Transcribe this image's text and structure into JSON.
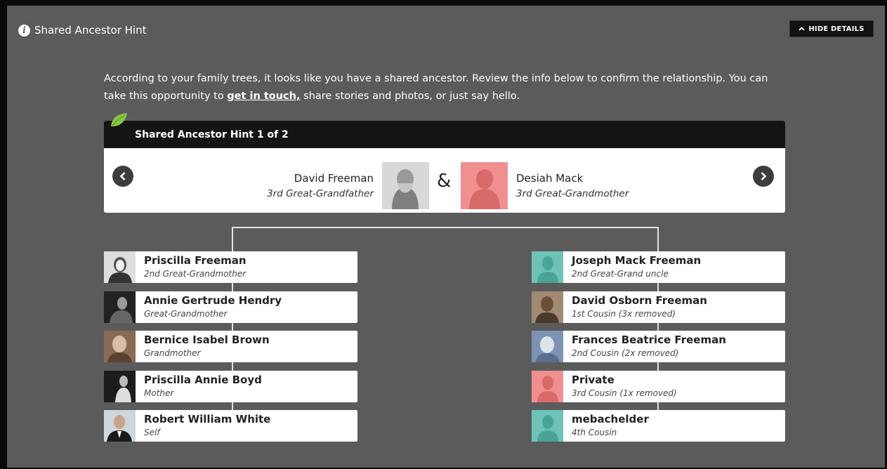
{
  "header": {
    "title": "Shared Ancestor Hint",
    "hide_details_label": "HIDE DETAILS"
  },
  "intro": {
    "text_before": "According to your family trees, it looks like you have a shared ancestor. Review the info below to confirm the relationship. You can take this opportunity to ",
    "link_text": "get in touch,",
    "text_after": " share stories and photos, or just say hello."
  },
  "hint": {
    "title": "Shared Ancestor Hint 1 of 2",
    "ampersand": "&",
    "ancestor1": {
      "name": "David Freeman",
      "relationship": "3rd Great-Grandfather"
    },
    "ancestor2": {
      "name": "Desiah Mack",
      "relationship": "3rd Great-Grandmother"
    }
  },
  "left_line": [
    {
      "name": "Priscilla Freeman",
      "relationship": "2nd Great-Grandmother"
    },
    {
      "name": "Annie Gertrude Hendry",
      "relationship": "Great-Grandmother"
    },
    {
      "name": "Bernice Isabel Brown",
      "relationship": "Grandmother"
    },
    {
      "name": "Priscilla Annie Boyd",
      "relationship": "Mother"
    },
    {
      "name": "Robert William White",
      "relationship": "Self"
    }
  ],
  "right_line": [
    {
      "name": "Joseph Mack Freeman",
      "relationship": "2nd Great-Grand uncle"
    },
    {
      "name": "David Osborn Freeman",
      "relationship": "1st Cousin (3x removed)"
    },
    {
      "name": "Frances Beatrice Freeman",
      "relationship": "2nd Cousin (2x removed)"
    },
    {
      "name": "Private",
      "relationship": "3rd Cousin (1x removed)"
    },
    {
      "name": "mebachelder",
      "relationship": "4th Cousin"
    }
  ],
  "colors": {
    "panel_bg": "#5b5b5b",
    "placeholder_teal": "#6dc3b8",
    "placeholder_pink": "#f08f8f"
  }
}
